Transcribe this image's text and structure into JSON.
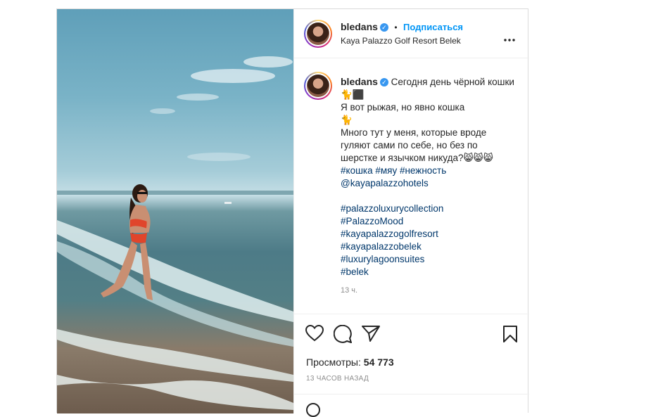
{
  "post": {
    "username": "bledans",
    "follow_label": "Подписаться",
    "separator": "•",
    "location": "Kaya Palazzo Golf Resort Belek",
    "more_label": "•••"
  },
  "caption": {
    "username": "bledans",
    "lines": [
      "Сегодня день чёрной кошки",
      "🐈⬛",
      "Я вот рыжая, но явно кошка",
      "🐈",
      "Много тут у меня, которые вроде",
      "гуляют сами по себе, но без по",
      "шерстке и язычком никуда?😸😸😸"
    ],
    "hashtags_line": "#кошка #мяу #нежность",
    "mention": "@kayapalazzohotels",
    "tags": [
      "#palazzoluxurycollection",
      "#PalazzoMood",
      "#kayapalazzogolfresort",
      "#kayapalazzobelek",
      "#luxurylagoonsuites",
      "#belek"
    ],
    "time": "13 ч."
  },
  "stats": {
    "views_label": "Просмотры:",
    "views_value": "54 773",
    "ago": "13 ЧАСОВ НАЗАД"
  },
  "icons": {
    "like": "heart-icon",
    "comment": "comment-icon",
    "share": "share-icon",
    "save": "bookmark-icon",
    "emoji": "emoji-icon",
    "verified": "verified-badge-icon",
    "more": "more-options-icon"
  },
  "colors": {
    "link": "#00376b",
    "follow": "#0095f6",
    "verified": "#3897f0",
    "muted": "#8e8e8e"
  }
}
